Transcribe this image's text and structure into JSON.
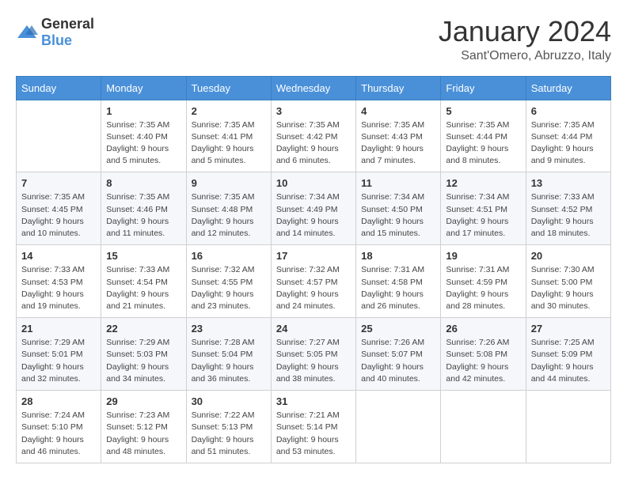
{
  "header": {
    "logo": {
      "text_general": "General",
      "text_blue": "Blue"
    },
    "title": "January 2024",
    "location": "Sant'Omero, Abruzzo, Italy"
  },
  "calendar": {
    "days_of_week": [
      "Sunday",
      "Monday",
      "Tuesday",
      "Wednesday",
      "Thursday",
      "Friday",
      "Saturday"
    ],
    "weeks": [
      [
        {
          "day": "",
          "info": ""
        },
        {
          "day": "1",
          "info": "Sunrise: 7:35 AM\nSunset: 4:40 PM\nDaylight: 9 hours\nand 5 minutes."
        },
        {
          "day": "2",
          "info": "Sunrise: 7:35 AM\nSunset: 4:41 PM\nDaylight: 9 hours\nand 5 minutes."
        },
        {
          "day": "3",
          "info": "Sunrise: 7:35 AM\nSunset: 4:42 PM\nDaylight: 9 hours\nand 6 minutes."
        },
        {
          "day": "4",
          "info": "Sunrise: 7:35 AM\nSunset: 4:43 PM\nDaylight: 9 hours\nand 7 minutes."
        },
        {
          "day": "5",
          "info": "Sunrise: 7:35 AM\nSunset: 4:44 PM\nDaylight: 9 hours\nand 8 minutes."
        },
        {
          "day": "6",
          "info": "Sunrise: 7:35 AM\nSunset: 4:44 PM\nDaylight: 9 hours\nand 9 minutes."
        }
      ],
      [
        {
          "day": "7",
          "info": "Sunrise: 7:35 AM\nSunset: 4:45 PM\nDaylight: 9 hours\nand 10 minutes."
        },
        {
          "day": "8",
          "info": "Sunrise: 7:35 AM\nSunset: 4:46 PM\nDaylight: 9 hours\nand 11 minutes."
        },
        {
          "day": "9",
          "info": "Sunrise: 7:35 AM\nSunset: 4:48 PM\nDaylight: 9 hours\nand 12 minutes."
        },
        {
          "day": "10",
          "info": "Sunrise: 7:34 AM\nSunset: 4:49 PM\nDaylight: 9 hours\nand 14 minutes."
        },
        {
          "day": "11",
          "info": "Sunrise: 7:34 AM\nSunset: 4:50 PM\nDaylight: 9 hours\nand 15 minutes."
        },
        {
          "day": "12",
          "info": "Sunrise: 7:34 AM\nSunset: 4:51 PM\nDaylight: 9 hours\nand 17 minutes."
        },
        {
          "day": "13",
          "info": "Sunrise: 7:33 AM\nSunset: 4:52 PM\nDaylight: 9 hours\nand 18 minutes."
        }
      ],
      [
        {
          "day": "14",
          "info": "Sunrise: 7:33 AM\nSunset: 4:53 PM\nDaylight: 9 hours\nand 19 minutes."
        },
        {
          "day": "15",
          "info": "Sunrise: 7:33 AM\nSunset: 4:54 PM\nDaylight: 9 hours\nand 21 minutes."
        },
        {
          "day": "16",
          "info": "Sunrise: 7:32 AM\nSunset: 4:55 PM\nDaylight: 9 hours\nand 23 minutes."
        },
        {
          "day": "17",
          "info": "Sunrise: 7:32 AM\nSunset: 4:57 PM\nDaylight: 9 hours\nand 24 minutes."
        },
        {
          "day": "18",
          "info": "Sunrise: 7:31 AM\nSunset: 4:58 PM\nDaylight: 9 hours\nand 26 minutes."
        },
        {
          "day": "19",
          "info": "Sunrise: 7:31 AM\nSunset: 4:59 PM\nDaylight: 9 hours\nand 28 minutes."
        },
        {
          "day": "20",
          "info": "Sunrise: 7:30 AM\nSunset: 5:00 PM\nDaylight: 9 hours\nand 30 minutes."
        }
      ],
      [
        {
          "day": "21",
          "info": "Sunrise: 7:29 AM\nSunset: 5:01 PM\nDaylight: 9 hours\nand 32 minutes."
        },
        {
          "day": "22",
          "info": "Sunrise: 7:29 AM\nSunset: 5:03 PM\nDaylight: 9 hours\nand 34 minutes."
        },
        {
          "day": "23",
          "info": "Sunrise: 7:28 AM\nSunset: 5:04 PM\nDaylight: 9 hours\nand 36 minutes."
        },
        {
          "day": "24",
          "info": "Sunrise: 7:27 AM\nSunset: 5:05 PM\nDaylight: 9 hours\nand 38 minutes."
        },
        {
          "day": "25",
          "info": "Sunrise: 7:26 AM\nSunset: 5:07 PM\nDaylight: 9 hours\nand 40 minutes."
        },
        {
          "day": "26",
          "info": "Sunrise: 7:26 AM\nSunset: 5:08 PM\nDaylight: 9 hours\nand 42 minutes."
        },
        {
          "day": "27",
          "info": "Sunrise: 7:25 AM\nSunset: 5:09 PM\nDaylight: 9 hours\nand 44 minutes."
        }
      ],
      [
        {
          "day": "28",
          "info": "Sunrise: 7:24 AM\nSunset: 5:10 PM\nDaylight: 9 hours\nand 46 minutes."
        },
        {
          "day": "29",
          "info": "Sunrise: 7:23 AM\nSunset: 5:12 PM\nDaylight: 9 hours\nand 48 minutes."
        },
        {
          "day": "30",
          "info": "Sunrise: 7:22 AM\nSunset: 5:13 PM\nDaylight: 9 hours\nand 51 minutes."
        },
        {
          "day": "31",
          "info": "Sunrise: 7:21 AM\nSunset: 5:14 PM\nDaylight: 9 hours\nand 53 minutes."
        },
        {
          "day": "",
          "info": ""
        },
        {
          "day": "",
          "info": ""
        },
        {
          "day": "",
          "info": ""
        }
      ]
    ]
  }
}
